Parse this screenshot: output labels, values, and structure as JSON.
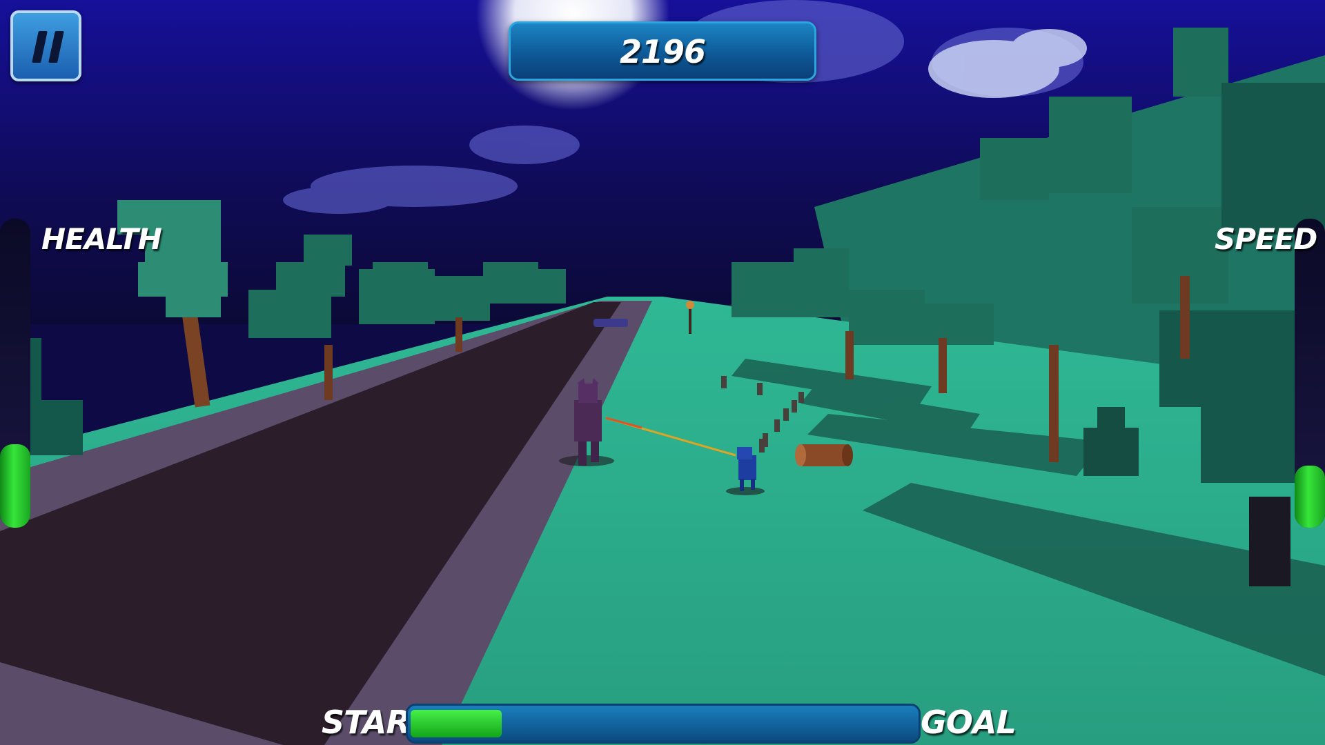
{
  "hud": {
    "score": "2196",
    "health_label": "HEALTH",
    "speed_label": "SPEED",
    "health_level": 0.27,
    "speed_level": 0.2,
    "progress": {
      "start_label": "START",
      "goal_label": "GOAL",
      "value": 0.18
    }
  },
  "icons": {
    "pause": "pause-icon"
  },
  "colors": {
    "sky": "#100b4e",
    "grass": "#35b592",
    "road": "#2e1e2c",
    "sidewalk": "#5e4f6e",
    "meter_fill": "#2fd835",
    "panel_blue": "#0e5a98"
  }
}
